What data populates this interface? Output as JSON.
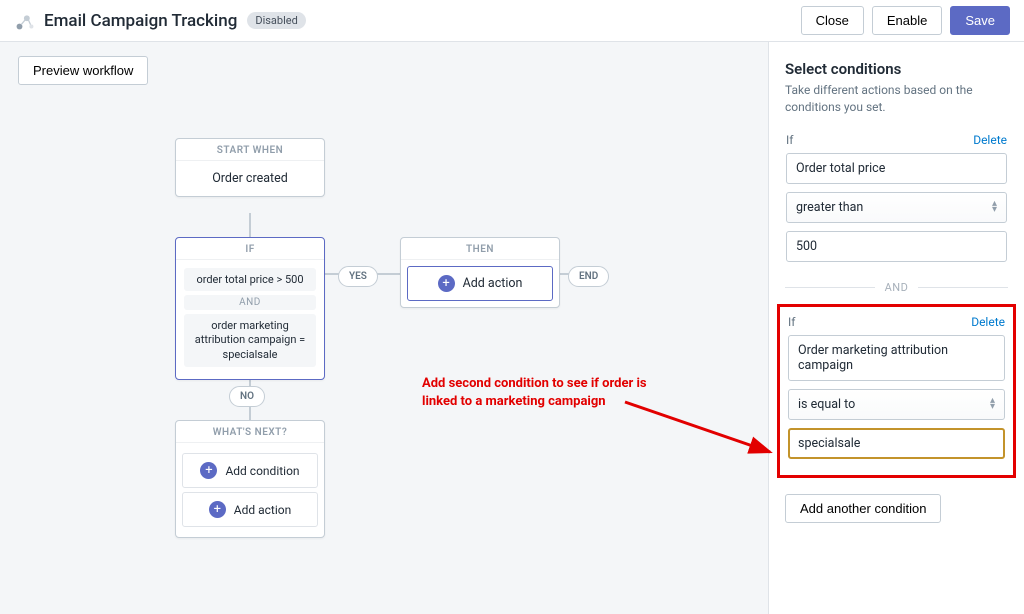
{
  "header": {
    "title": "Email Campaign Tracking",
    "badge": "Disabled",
    "close": "Close",
    "enable": "Enable",
    "save": "Save"
  },
  "toolbar": {
    "preview": "Preview workflow"
  },
  "flow": {
    "start_hdr": "START WHEN",
    "start_text": "Order created",
    "if_hdr": "IF",
    "chip1": "order total price > 500",
    "chip_and": "AND",
    "chip2": "order marketing attribution campaign = specialsale",
    "then_hdr": "THEN",
    "add_action": "Add action",
    "next_hdr": "WHAT'S NEXT?",
    "add_condition": "Add condition",
    "yes": "YES",
    "no": "NO",
    "end": "END"
  },
  "sidebar": {
    "title": "Select conditions",
    "subtitle": "Take different actions based on the conditions you set.",
    "if_label": "If",
    "delete": "Delete",
    "and": "AND",
    "add_another": "Add another condition",
    "cond1": {
      "field": "Order total price",
      "op": "greater than",
      "value": "500"
    },
    "cond2": {
      "field": "Order marketing attribution campaign",
      "op": "is equal to",
      "value": "specialsale"
    }
  },
  "annotation": "Add second condition to see if order is linked to a marketing campaign"
}
